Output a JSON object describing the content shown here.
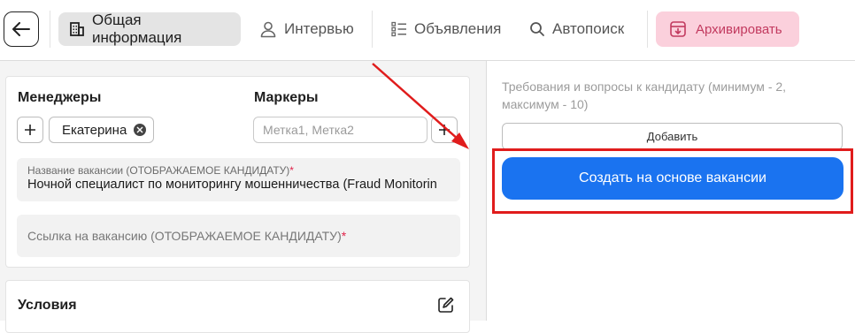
{
  "tabs": [
    {
      "label": "Общая информация",
      "active": true,
      "icon": "building-icon"
    },
    {
      "label": "Интервью",
      "active": false,
      "icon": "user-icon"
    },
    {
      "label": "Объявления",
      "active": false,
      "icon": "list-icon"
    },
    {
      "label": "Автопоиск",
      "active": false,
      "icon": "search-icon"
    }
  ],
  "archive_label": "Архивировать",
  "managers": {
    "title": "Менеджеры",
    "chip": "Екатерина"
  },
  "markers": {
    "title": "Маркеры",
    "placeholder": "Метка1, Метка2"
  },
  "vacancy_name": {
    "label": "Название вакансии (ОТОБРАЖАЕМОЕ КАНДИДАТУ)",
    "required_mark": "*",
    "value": "Ночной специалист по мониторингу мошенничества (Fraud Monitorin"
  },
  "vacancy_link": {
    "label": "Ссылка на вакансию (ОТОБРАЖАЕМОЕ КАНДИДАТУ)",
    "required_mark": "*"
  },
  "conditions": {
    "title": "Условия"
  },
  "requirements_hint": "Требования и вопросы к кандидату (минимум - 2, максимум - 10)",
  "add_button": "Добавить",
  "create_button": "Создать на основе вакансии",
  "colors": {
    "primary": "#1a73f0",
    "archive_bg": "#fbd0dc",
    "archive_text": "#c23a5f",
    "annotation": "#e01c1c"
  }
}
